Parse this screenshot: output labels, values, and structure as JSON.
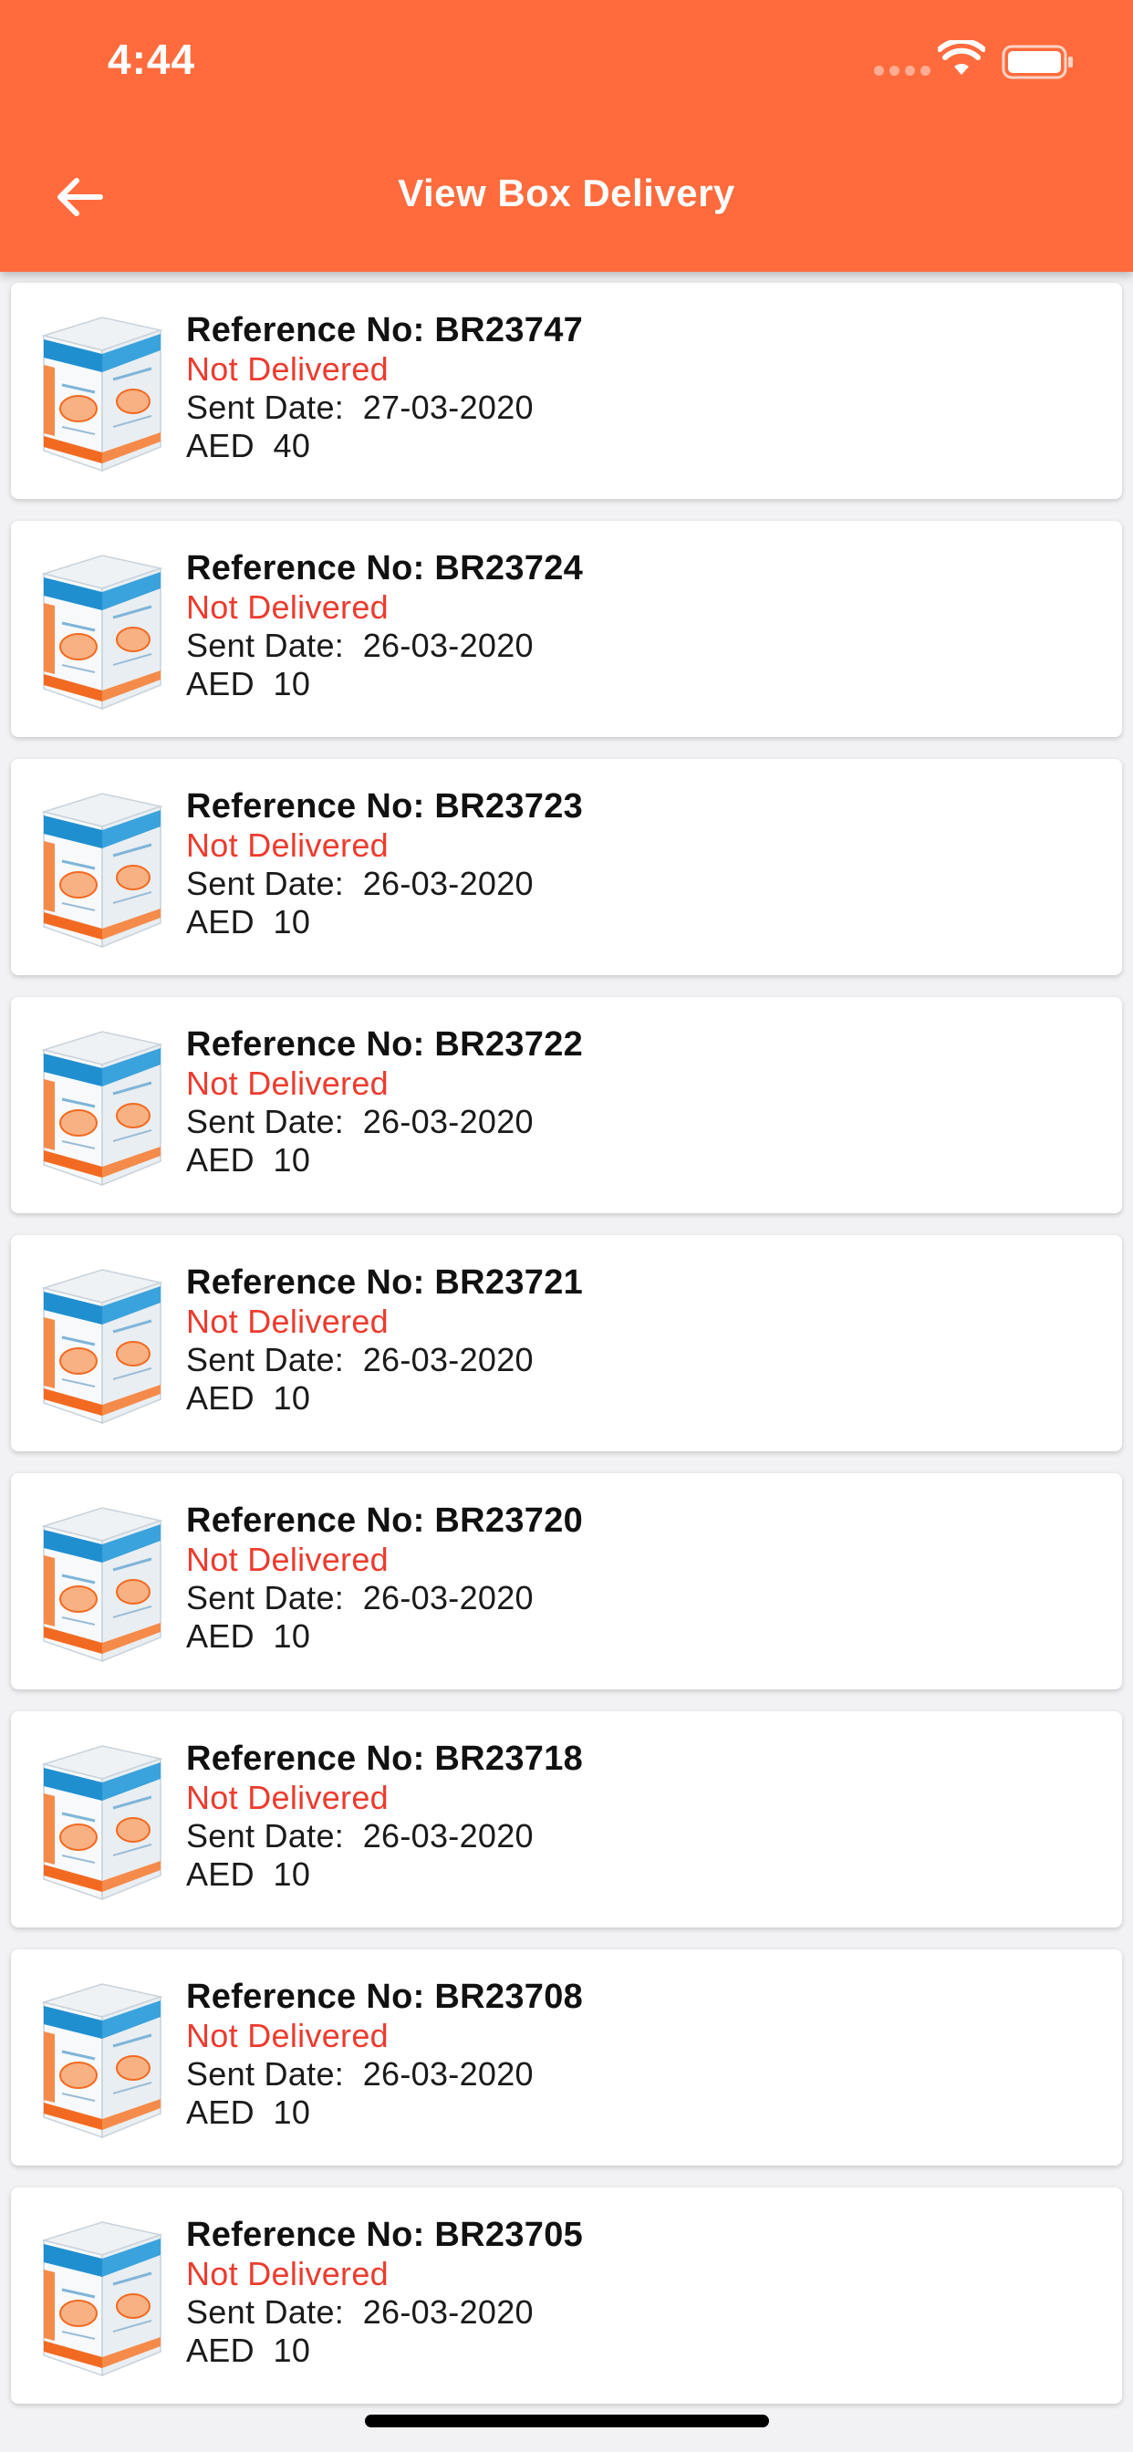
{
  "status_bar": {
    "time": "4:44"
  },
  "header": {
    "title": "View Box Delivery",
    "back_icon": "arrow-left-icon"
  },
  "colors": {
    "header": "#ff6b3d",
    "status_not_delivered": "#ec3b2e"
  },
  "deliveries": [
    {
      "ref_label": "Reference No:",
      "ref_value": "BR23747",
      "status": "Not Delivered",
      "date_label": "Sent Date:",
      "date": "27-03-2020",
      "currency": "AED",
      "amount": "40"
    },
    {
      "ref_label": "Reference No:",
      "ref_value": "BR23724",
      "status": "Not Delivered",
      "date_label": "Sent Date:",
      "date": "26-03-2020",
      "currency": "AED",
      "amount": "10"
    },
    {
      "ref_label": "Reference No:",
      "ref_value": "BR23723",
      "status": "Not Delivered",
      "date_label": "Sent Date:",
      "date": "26-03-2020",
      "currency": "AED",
      "amount": "10"
    },
    {
      "ref_label": "Reference No:",
      "ref_value": "BR23722",
      "status": "Not Delivered",
      "date_label": "Sent Date:",
      "date": "26-03-2020",
      "currency": "AED",
      "amount": "10"
    },
    {
      "ref_label": "Reference No:",
      "ref_value": "BR23721",
      "status": "Not Delivered",
      "date_label": "Sent Date:",
      "date": "26-03-2020",
      "currency": "AED",
      "amount": "10"
    },
    {
      "ref_label": "Reference No:",
      "ref_value": "BR23720",
      "status": "Not Delivered",
      "date_label": "Sent Date:",
      "date": "26-03-2020",
      "currency": "AED",
      "amount": "10"
    },
    {
      "ref_label": "Reference No:",
      "ref_value": "BR23718",
      "status": "Not Delivered",
      "date_label": "Sent Date:",
      "date": "26-03-2020",
      "currency": "AED",
      "amount": "10"
    },
    {
      "ref_label": "Reference No:",
      "ref_value": "BR23708",
      "status": "Not Delivered",
      "date_label": "Sent Date:",
      "date": "26-03-2020",
      "currency": "AED",
      "amount": "10"
    },
    {
      "ref_label": "Reference No:",
      "ref_value": "BR23705",
      "status": "Not Delivered",
      "date_label": "Sent Date:",
      "date": "26-03-2020",
      "currency": "AED",
      "amount": "10"
    }
  ]
}
